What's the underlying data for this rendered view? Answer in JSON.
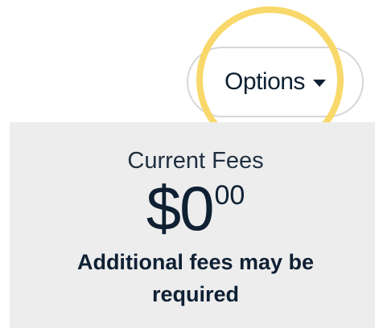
{
  "options_button": {
    "label": "Options",
    "icon": "caret-down-icon"
  },
  "highlight": {
    "color": "#f8d86a"
  },
  "fees": {
    "title": "Current Fees",
    "currency": "$",
    "dollars": "0",
    "cents": "00",
    "note": "Additional fees may be required"
  },
  "colors": {
    "panel_background": "#ededed",
    "text": "#0f2033"
  }
}
